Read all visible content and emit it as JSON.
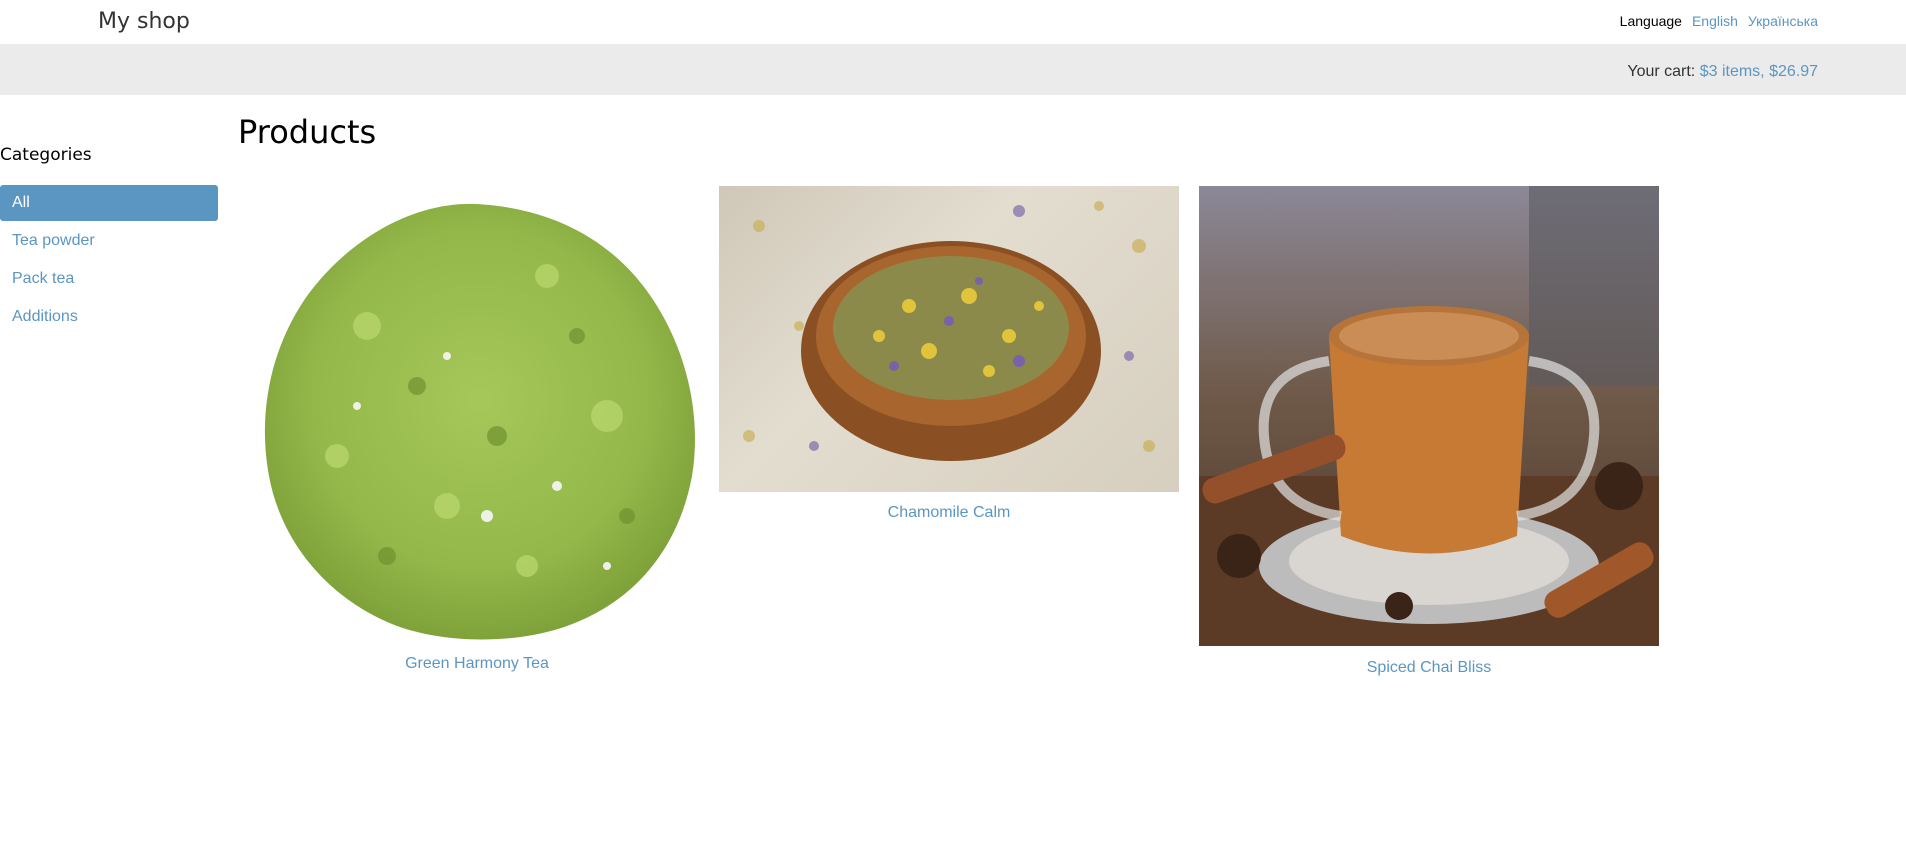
{
  "header": {
    "logo": "My shop",
    "language_label": "Language",
    "languages": [
      "English",
      "Українська"
    ]
  },
  "cart": {
    "label": "Your cart:",
    "summary": "$3 items, $26.97"
  },
  "sidebar": {
    "title": "Categories",
    "items": [
      {
        "label": "All",
        "active": true
      },
      {
        "label": "Tea powder",
        "active": false
      },
      {
        "label": "Pack tea",
        "active": false
      },
      {
        "label": "Additions",
        "active": false
      }
    ]
  },
  "main": {
    "title": "Products",
    "products": [
      {
        "name": "Green Harmony Tea",
        "image": "matcha-powder-image"
      },
      {
        "name": "Chamomile Calm",
        "image": "chamomile-bowl-image"
      },
      {
        "name": "Spiced Chai Bliss",
        "image": "chai-cup-image"
      }
    ]
  },
  "colors": {
    "accent": "#5b96c2",
    "subheader_bg": "#ebebeb",
    "text": "#333333"
  }
}
